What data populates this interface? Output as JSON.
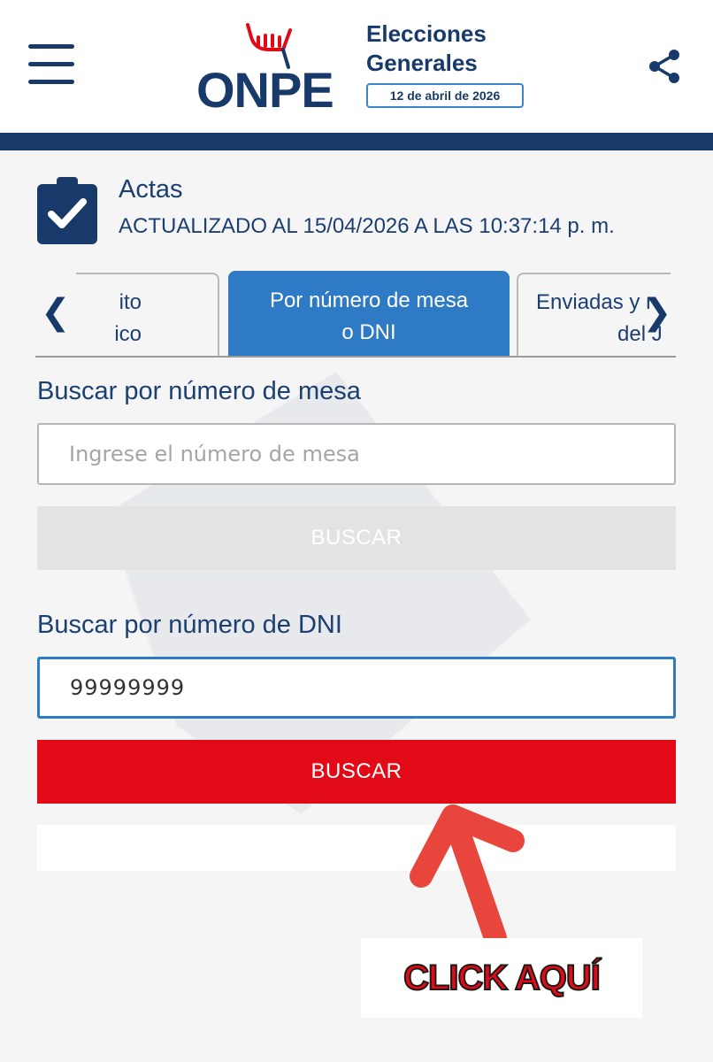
{
  "header": {
    "menu_icon": "hamburger-menu-icon",
    "logo_text": "ONPE",
    "title_line1": "Elecciones",
    "title_line2": "Generales",
    "date_badge": "12 de abril de 2026",
    "share_icon": "share-icon"
  },
  "actas": {
    "icon": "clipboard-check-icon",
    "title": "Actas",
    "updated": "ACTUALIZADO AL 15/04/2026 A LAS 10:37:14 p. m."
  },
  "tabs": {
    "prev_arrow": "❮",
    "next_arrow": "❯",
    "items": [
      {
        "line1": "ito",
        "line2": "ico"
      },
      {
        "line1": "Por número de mesa",
        "line2": "o DNI"
      },
      {
        "line1": "Enviadas y r",
        "line2": "del J"
      }
    ],
    "active_index": 1
  },
  "search_mesa": {
    "label": "Buscar por número de mesa",
    "placeholder": "Ingrese el número de mesa",
    "value": "",
    "button": "BUSCAR"
  },
  "search_dni": {
    "label": "Buscar por número de DNI",
    "value": "99999999",
    "button": "BUSCAR"
  },
  "annotation": {
    "text": "CLICK AQUÍ"
  },
  "colors": {
    "navy": "#173a6b",
    "active_tab": "#2f7ac4",
    "red_button": "#e20a16",
    "disabled_button": "#e3e3e3"
  }
}
